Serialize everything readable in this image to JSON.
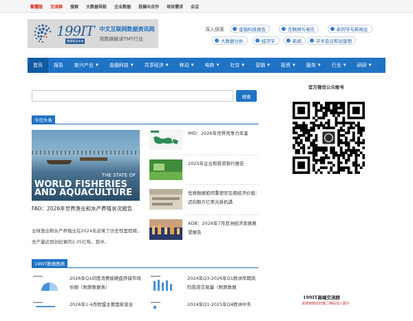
{
  "topbar": {
    "links": [
      "繁體版",
      "交流群",
      "搜索",
      "大数据导航",
      "企业数据",
      "投稿与合作",
      "项目需求",
      "会议"
    ]
  },
  "header": {
    "logo_text": "199IT",
    "logo_sub": "数据驱动未来",
    "slogan_1": "中文互联网数据资讯网",
    "slogan_2": "用数据解读TMT行业",
    "deep_search_label": "深入探索",
    "tags": [
      "金融科技报告",
      "互联网与电信",
      "新同学与新闻业",
      "大数据分析",
      "经济学",
      "新闻",
      "学术会议和出版物"
    ]
  },
  "nav": {
    "items": [
      {
        "label": "首页",
        "caret": false
      },
      {
        "label": "报告",
        "caret": false
      },
      {
        "label": "新兴产业",
        "caret": true
      },
      {
        "label": "金融科技",
        "caret": true
      },
      {
        "label": "共享经济",
        "caret": true
      },
      {
        "label": "移动",
        "caret": true
      },
      {
        "label": "电商",
        "caret": true
      },
      {
        "label": "社交",
        "caret": true
      },
      {
        "label": "营销",
        "caret": true
      },
      {
        "label": "投资",
        "caret": true
      },
      {
        "label": "服务",
        "caret": true
      },
      {
        "label": "行业",
        "caret": true
      },
      {
        "label": "研研",
        "caret": true
      }
    ]
  },
  "search": {
    "placeholder": "",
    "button_label": "搜索"
  },
  "today": {
    "heading": "今日头条",
    "big": {
      "image_caption_1": "THE STATE OF",
      "image_caption_2": "WORLD FISHERIES AND AQUACULTURE",
      "title": "FAO：2026年世界渔业和水产养殖状况报告",
      "desc": "全球渔业和水产养殖业在2024年迎来了历史性里程碑，总产量达到创纪录的2.35亿吨，其中，"
    },
    "items": [
      {
        "title": "IMD：2026年世界竞争力年鉴"
      },
      {
        "title": "2025年企业和投资银行报告"
      },
      {
        "title": "优质数据如何重塑罕见病经济价值：迈向数万亿美元新机遇"
      },
      {
        "title": "ADB：2026年7月亚洲经济发展展望报告"
      }
    ]
  },
  "charts": {
    "heading": "199IT数据图表",
    "items": [
      {
        "title": "2026年Q1印度消费级硬盘存储市场份额（附原数据表）"
      },
      {
        "title": "2024年Q3-2026年Q1欧洲早期风险投资交易量（附原数据"
      },
      {
        "title": "2026年1-4月欧盟主要国家混合"
      },
      {
        "title": "2024年Q1-2025年Q4欧洲中东"
      }
    ]
  },
  "sidebar": {
    "wechat_title": "官方微信公众账号",
    "group_title": "199IT高端交流群",
    "group_sub": "请使用微信扫描二维码加入圈子"
  }
}
